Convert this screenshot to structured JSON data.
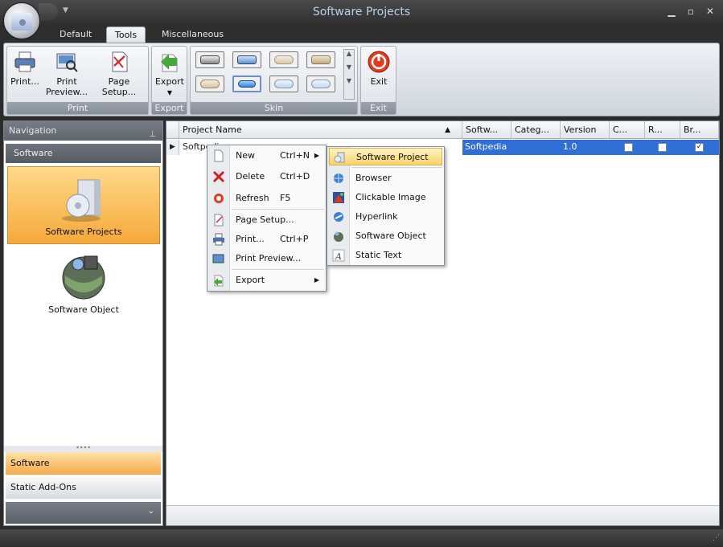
{
  "window": {
    "title": "Software Projects"
  },
  "tabs": [
    {
      "label": "Default"
    },
    {
      "label": "Tools"
    },
    {
      "label": "Miscellaneous"
    }
  ],
  "ribbon": {
    "print_group": {
      "label": "Print",
      "print": "Print...",
      "print_preview_1": "Print",
      "print_preview_2": "Preview...",
      "page_setup": "Page Setup..."
    },
    "export_group": {
      "label": "Export",
      "export": "Export"
    },
    "skin_group": {
      "label": "Skin"
    },
    "exit_group": {
      "label": "Exit",
      "exit": "Exit"
    }
  },
  "navigation": {
    "header": "Navigation",
    "group_title": "Software",
    "items": [
      {
        "label": "Software Projects"
      },
      {
        "label": "Software Object"
      }
    ],
    "bars": [
      {
        "label": "Software"
      },
      {
        "label": "Static Add-Ons"
      }
    ]
  },
  "grid": {
    "columns": [
      "Project Name",
      "Softw...",
      "Categ...",
      "Version",
      "C...",
      "R...",
      "Br..."
    ],
    "rows": [
      {
        "name": "Softpedia",
        "software": "Softpedia",
        "category": "",
        "version": "1.0",
        "c": false,
        "r": false,
        "br": true
      }
    ]
  },
  "context_menu": {
    "items": [
      {
        "label": "New",
        "shortcut": "Ctrl+N"
      },
      {
        "label": "Delete",
        "shortcut": "Ctrl+D"
      },
      {
        "label": "Refresh",
        "shortcut": "F5"
      },
      {
        "label": "Page Setup..."
      },
      {
        "label": "Print...",
        "shortcut": "Ctrl+P"
      },
      {
        "label": "Print Preview..."
      },
      {
        "label": "Export"
      }
    ]
  },
  "submenu": {
    "items": [
      {
        "label": "Software Project"
      },
      {
        "label": "Browser"
      },
      {
        "label": "Clickable Image"
      },
      {
        "label": "Hyperlink"
      },
      {
        "label": "Software Object"
      },
      {
        "label": "Static Text"
      }
    ]
  },
  "colors": {
    "selection_blue": "#2f6fd6",
    "nav_selected_orange": "#f5a93a",
    "menu_highlight": "#f8d46a"
  }
}
